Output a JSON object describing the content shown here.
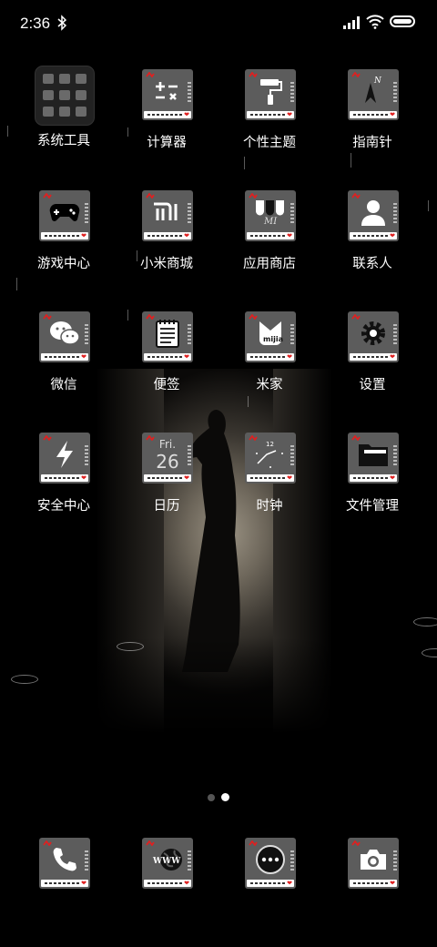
{
  "status_bar": {
    "time": "2:36",
    "bluetooth_icon": "bluetooth-icon",
    "signal_icon": "signal-bars-icon",
    "wifi_icon": "wifi-icon",
    "battery_icon": "battery-icon"
  },
  "folder": {
    "label": "系统工具"
  },
  "apps": [
    {
      "label": "计算器",
      "icon": "calculator-icon"
    },
    {
      "label": "个性主题",
      "icon": "paint-roller-icon"
    },
    {
      "label": "指南针",
      "icon": "compass-icon"
    },
    {
      "label": "游戏中心",
      "icon": "gamepad-icon"
    },
    {
      "label": "小米商城",
      "icon": "mi-logo-icon"
    },
    {
      "label": "应用商店",
      "icon": "app-store-icon"
    },
    {
      "label": "联系人",
      "icon": "person-icon"
    },
    {
      "label": "微信",
      "icon": "wechat-icon"
    },
    {
      "label": "便签",
      "icon": "notepad-icon"
    },
    {
      "label": "米家",
      "icon": "mijia-icon"
    },
    {
      "label": "设置",
      "icon": "gear-icon"
    },
    {
      "label": "安全中心",
      "icon": "shield-bolt-icon"
    },
    {
      "label": "日历",
      "icon": "calendar-icon",
      "day": "Fri.",
      "date": "26"
    },
    {
      "label": "时钟",
      "icon": "clock-icon",
      "dial": "12"
    },
    {
      "label": "文件管理",
      "icon": "folder-icon"
    }
  ],
  "dock": [
    {
      "icon": "phone-icon"
    },
    {
      "icon": "browser-globe-icon",
      "text": "WWW"
    },
    {
      "icon": "messages-icon"
    },
    {
      "icon": "camera-icon"
    }
  ],
  "pager": {
    "pages": 2,
    "active": 2
  }
}
